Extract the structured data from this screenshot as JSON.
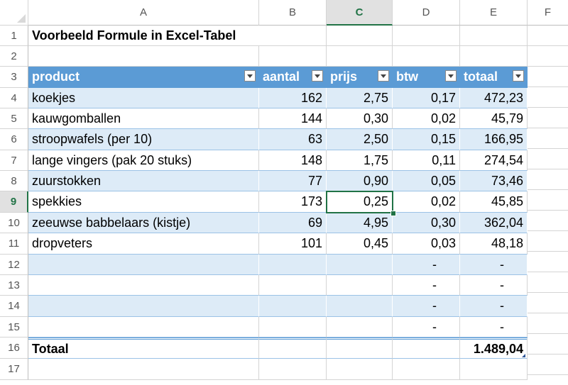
{
  "columns": [
    "A",
    "B",
    "C",
    "D",
    "E",
    "F"
  ],
  "active_column": "C",
  "active_row": "9",
  "rows": [
    "1",
    "2",
    "3",
    "4",
    "5",
    "6",
    "7",
    "8",
    "9",
    "10",
    "11",
    "12",
    "13",
    "14",
    "15",
    "16",
    "17"
  ],
  "title": "Voorbeeld Formule in Excel-Tabel",
  "table": {
    "headers": [
      "product",
      "aantal",
      "prijs",
      "btw",
      "totaal"
    ],
    "data": [
      [
        "koekjes",
        "162",
        "2,75",
        "0,17",
        "472,23"
      ],
      [
        "kauwgomballen",
        "144",
        "0,30",
        "0,02",
        "45,79"
      ],
      [
        "stroopwafels (per 10)",
        "63",
        "2,50",
        "0,15",
        "166,95"
      ],
      [
        "lange vingers (pak 20 stuks)",
        "148",
        "1,75",
        "0,11",
        "274,54"
      ],
      [
        "zuurstokken",
        "77",
        "0,90",
        "0,05",
        "73,46"
      ],
      [
        "spekkies",
        "173",
        "0,25",
        "0,02",
        "45,85"
      ],
      [
        "zeeuwse babbelaars (kistje)",
        "69",
        "4,95",
        "0,30",
        "362,04"
      ],
      [
        "dropveters",
        "101",
        "0,45",
        "0,03",
        "48,18"
      ],
      [
        "",
        "",
        "",
        "-",
        "-"
      ],
      [
        "",
        "",
        "",
        "-",
        "-"
      ],
      [
        "",
        "",
        "",
        "-",
        "-"
      ],
      [
        "",
        "",
        "",
        "-",
        "-"
      ]
    ],
    "total_label": "Totaal",
    "total_value": "1.489,04"
  },
  "colors": {
    "header_bg": "#5b9bd5",
    "band_bg": "#ddebf7",
    "selection": "#217346"
  }
}
